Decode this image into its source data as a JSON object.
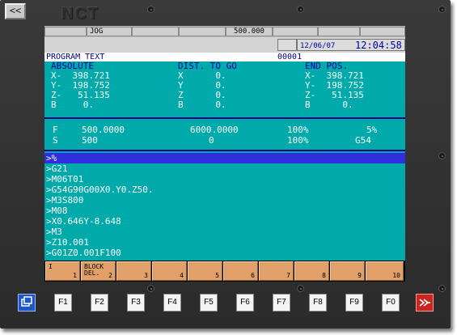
{
  "header": {
    "back_label": "<<",
    "brand": "NCT"
  },
  "status_bar": {
    "mode": "JOG",
    "feed_display": "500.000"
  },
  "info": {
    "date": "12/06/07",
    "time": "12:04:58"
  },
  "program": {
    "title": "PROGRAM TEXT",
    "number": "00001"
  },
  "positions": {
    "absolute": {
      "label": "ABSOLUTE",
      "rows": [
        "X-  398.721",
        "Y-  198.752",
        "Z-   51.135",
        "B     0."
      ]
    },
    "dist_to_go": {
      "label": "DIST. TO GO",
      "rows": [
        "X      0.",
        "Y      0.",
        "Z      0.",
        "B      0."
      ]
    },
    "end_pos": {
      "label": "END POS.",
      "rows": [
        "X-  398.721",
        "Y-  198.752",
        "Z-   51.135",
        "B      0."
      ]
    }
  },
  "feed": {
    "f_label": "F",
    "f_value": "500.0000",
    "f_mid": "6000.0000",
    "f_pct": "100%",
    "f_right": "5%",
    "s_label": "S",
    "s_value": "500",
    "s_mid": "0",
    "s_pct": "100%",
    "s_right": "G54"
  },
  "code_lines": [
    ">%",
    ">G21",
    ">M06T01",
    ">G54G90G00X0.Y0.Z50.",
    ">M3S800",
    ">M08",
    ">X0.646Y-8.648",
    ">M3",
    ">Z10.001",
    ">G01Z0.001F100"
  ],
  "softkeys": [
    {
      "label": "I",
      "num": "1"
    },
    {
      "label": "BLOCK\nDEL.",
      "num": "2"
    },
    {
      "label": "",
      "num": "3"
    },
    {
      "label": "",
      "num": "4"
    },
    {
      "label": "",
      "num": "5"
    },
    {
      "label": "",
      "num": "6"
    },
    {
      "label": "",
      "num": "7"
    },
    {
      "label": "",
      "num": "8"
    },
    {
      "label": "",
      "num": "9"
    },
    {
      "label": "",
      "num": "10"
    }
  ],
  "function_keys": [
    "F1",
    "F2",
    "F3",
    "F4",
    "F5",
    "F6",
    "F7",
    "F8",
    "F9",
    "F0"
  ],
  "icons": {
    "left": "windows-icon",
    "right": "exit-arrow-icon"
  },
  "colors": {
    "screen": "#00aaaa",
    "selected_line": "#2f2fe0",
    "softkey": "#e1a06a"
  }
}
